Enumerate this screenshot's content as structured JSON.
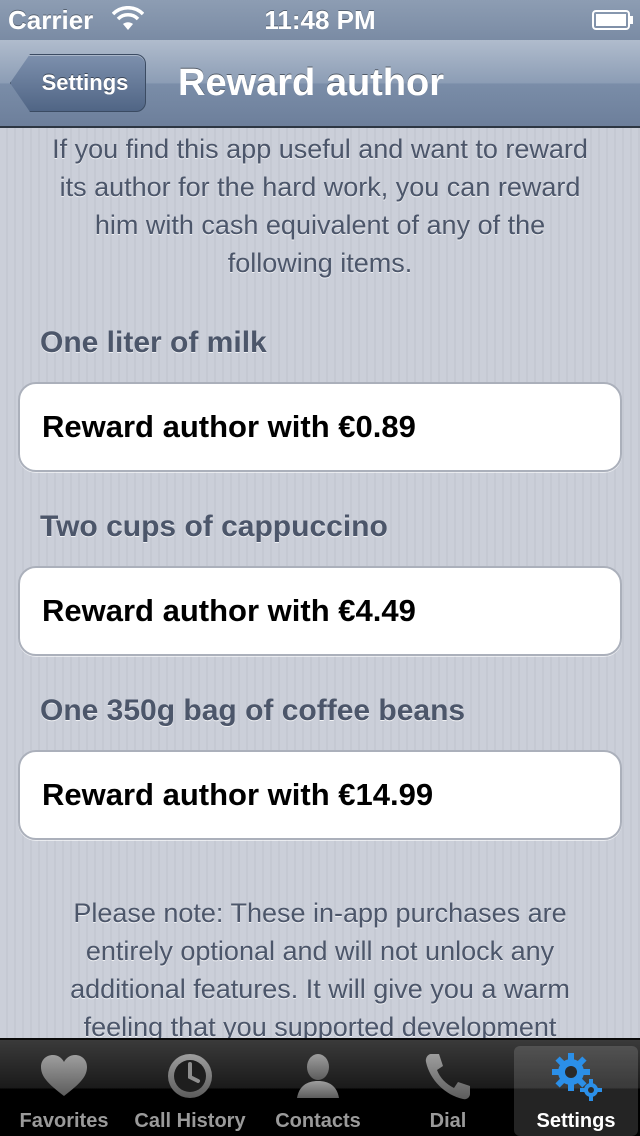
{
  "status_bar": {
    "carrier": "Carrier",
    "time": "11:48 PM"
  },
  "nav_bar": {
    "back_label": "Settings",
    "title": "Reward author"
  },
  "intro_text": "If you find this app useful and want to reward its author for the hard work, you can reward him with cash equivalent of any of the following items.",
  "rewards": [
    {
      "header": "One liter of milk",
      "button_label": "Reward author with €0.89"
    },
    {
      "header": "Two cups of cappuccino",
      "button_label": "Reward author with €4.49"
    },
    {
      "header": "One 350g bag of coffee beans",
      "button_label": "Reward author with €14.99"
    }
  ],
  "note_text": "Please note: These in-app purchases are entirely optional and will not unlock any additional features. It will give you a warm feeling that you supported development",
  "tab_bar": {
    "tabs": [
      {
        "label": "Favorites",
        "icon": "heart-icon",
        "selected": false
      },
      {
        "label": "Call History",
        "icon": "clock-icon",
        "selected": false
      },
      {
        "label": "Contacts",
        "icon": "person-icon",
        "selected": false
      },
      {
        "label": "Dial",
        "icon": "phone-icon",
        "selected": false
      },
      {
        "label": "Settings",
        "icon": "gears-icon",
        "selected": true
      }
    ]
  },
  "colors": {
    "nav_bar": "#7a8da8",
    "background": "#c8ccd7",
    "section_text": "#4c566a",
    "tab_selected_icon": "#2b8fe8"
  }
}
